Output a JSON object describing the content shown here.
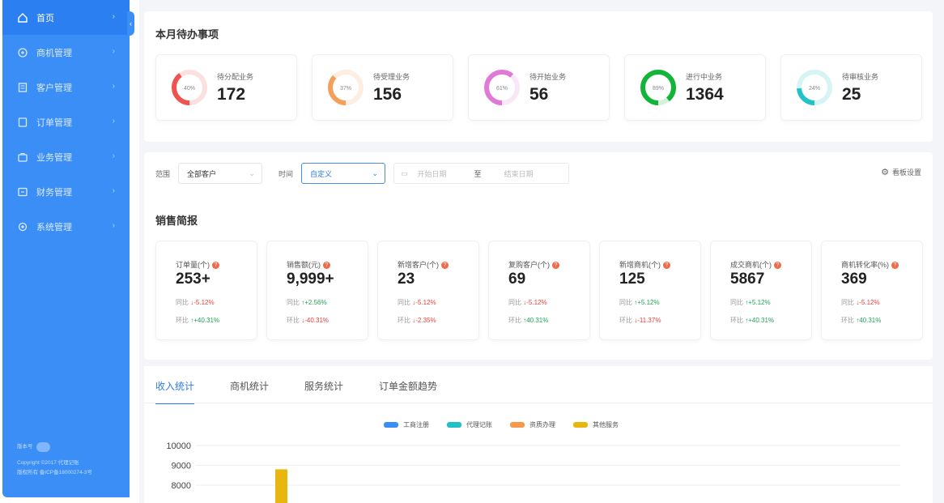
{
  "sidebar": {
    "items": [
      {
        "label": "首页",
        "icon": "home-icon",
        "active": true
      },
      {
        "label": "商机管理",
        "icon": "opportunity-icon"
      },
      {
        "label": "客户管理",
        "icon": "customer-icon"
      },
      {
        "label": "订单管理",
        "icon": "order-icon"
      },
      {
        "label": "业务管理",
        "icon": "business-icon"
      },
      {
        "label": "财务管理",
        "icon": "finance-icon"
      },
      {
        "label": "系统管理",
        "icon": "settings-icon"
      }
    ],
    "footer": {
      "version_label": "版本号",
      "copyright": "Copyright ©2017 代理记账",
      "icp": "版权所有 备ICP备18000274-3号"
    }
  },
  "todo": {
    "title": "本月待办事项",
    "items": [
      {
        "label": "待分配业务",
        "value": "172",
        "percent": 40,
        "percent_label": "40%",
        "color": "#ef5350"
      },
      {
        "label": "待受理业务",
        "value": "156",
        "percent": 37,
        "percent_label": "37%",
        "color": "#f5a05a"
      },
      {
        "label": "待开始业务",
        "value": "56",
        "percent": 61,
        "percent_label": "61%",
        "color": "#e07ad6"
      },
      {
        "label": "进行中业务",
        "value": "1364",
        "percent": 89,
        "percent_label": "89%",
        "color": "#12b43a"
      },
      {
        "label": "待审核业务",
        "value": "25",
        "percent": 24,
        "percent_label": "24%",
        "color": "#22c2c9"
      }
    ]
  },
  "filters": {
    "scope_label": "范围",
    "scope_value": "全部客户",
    "time_label": "时间",
    "time_value": "自定义",
    "start_placeholder": "开始日期",
    "range_sep": "至",
    "end_placeholder": "结束日期",
    "view_settings": "看板设置"
  },
  "sales": {
    "title": "销售简报",
    "yoy_label": "同比",
    "mom_label": "环比",
    "stats": [
      {
        "label": "订单量(个)",
        "value": "253+",
        "yoy": "↓-5.12%",
        "yoy_dir": "down",
        "mom": "↑+40.31%",
        "mom_dir": "up"
      },
      {
        "label": "销售额(元)",
        "value": "9,999+",
        "yoy": "↑+2.56%",
        "yoy_dir": "up",
        "mom": "↓-40.31%",
        "mom_dir": "down"
      },
      {
        "label": "新增客户(个)",
        "value": "23",
        "yoy": "↓-5.12%",
        "yoy_dir": "down",
        "mom": "↓-2.35%",
        "mom_dir": "down"
      },
      {
        "label": "复购客户(个)",
        "value": "69",
        "yoy": "↓-5.12%",
        "yoy_dir": "down",
        "mom": "↑40.31%",
        "mom_dir": "up"
      },
      {
        "label": "新增商机(个)",
        "value": "125",
        "yoy": "↑+5.12%",
        "yoy_dir": "up",
        "mom": "↓-11.37%",
        "mom_dir": "down"
      },
      {
        "label": "成交商机(个)",
        "value": "5867",
        "yoy": "↑+5.12%",
        "yoy_dir": "up",
        "mom": "↑+40.31%",
        "mom_dir": "up"
      },
      {
        "label": "商机转化率(%)",
        "value": "369",
        "yoy": "↓-5.12%",
        "yoy_dir": "down",
        "mom": "↑40.31%",
        "mom_dir": "up"
      }
    ]
  },
  "chart_tabs": [
    "收入统计",
    "商机统计",
    "服务统计",
    "订单金额趋势"
  ],
  "chart_data": {
    "type": "bar",
    "title": "",
    "series": [
      {
        "name": "工商注册",
        "color": "#3a8ef6"
      },
      {
        "name": "代理记账",
        "color": "#1fc0c8"
      },
      {
        "name": "资质办理",
        "color": "#f59a4a"
      },
      {
        "name": "其他服务",
        "color": "#e8b70f"
      }
    ],
    "y_ticks": [
      "10000",
      "9000",
      "8000"
    ],
    "visible_bars": [
      {
        "series": "其他服务",
        "value": 8800
      }
    ]
  }
}
